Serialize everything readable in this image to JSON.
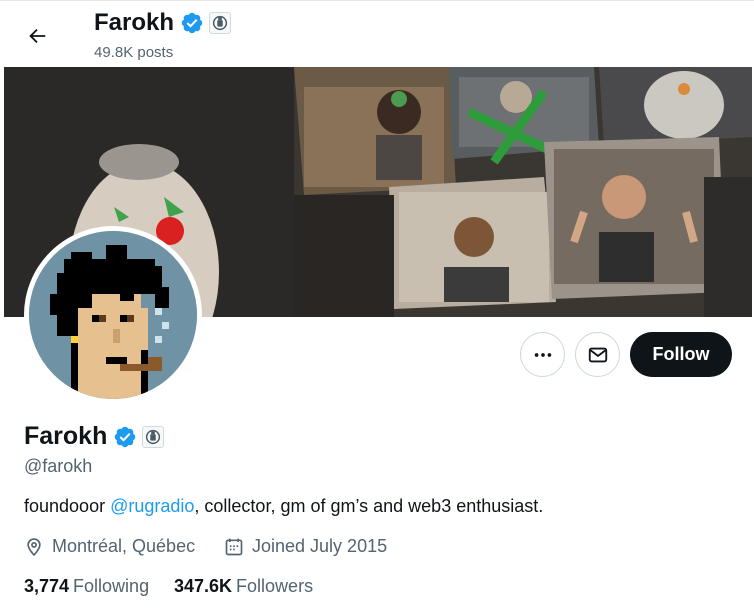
{
  "header": {
    "name": "Farokh",
    "posts": "49.8K posts"
  },
  "profile": {
    "name": "Farokh",
    "handle": "@farokh",
    "bio_prefix": "foundooor ",
    "bio_mention": "@rugradio",
    "bio_suffix": ", collector, gm of gm’s and web3 enthusiast.",
    "location": "Montréal, Québec",
    "joined": "Joined July 2015",
    "following_count": "3,774",
    "following_label": "Following",
    "followers_count": "347.6K",
    "followers_label": "Followers"
  },
  "actions": {
    "follow_label": "Follow"
  },
  "icons": {
    "back": "arrow-left-icon",
    "verified": "verified-badge-icon",
    "affiliate": "affiliate-badge-icon",
    "more": "more-icon",
    "message": "envelope-icon",
    "location": "location-pin-icon",
    "calendar": "calendar-icon"
  },
  "colors": {
    "accent": "#1d9bf0",
    "follow_button": "#0f1419",
    "secondary_text": "#536471"
  }
}
